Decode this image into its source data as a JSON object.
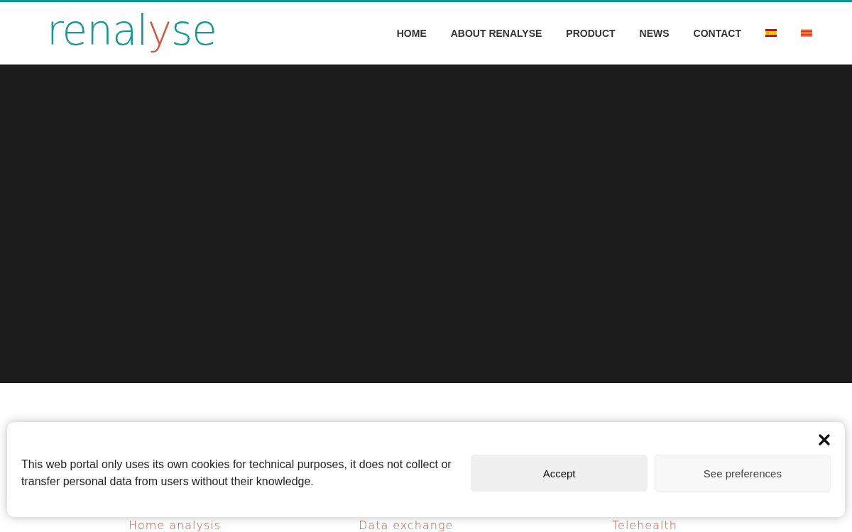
{
  "logo": [
    {
      "text": "renal",
      "accent": false
    },
    {
      "text": "y",
      "accent": true
    },
    {
      "text": "se",
      "accent": false
    }
  ],
  "nav": [
    {
      "label": "HOME"
    },
    {
      "label": "ABOUT RENALYSE"
    },
    {
      "label": "PRODUCT"
    },
    {
      "label": "NEWS"
    },
    {
      "label": "CONTACT"
    }
  ],
  "languages": [
    {
      "kind": "es"
    },
    {
      "kind": "ca"
    }
  ],
  "features": [
    {
      "title": "Home analysis"
    },
    {
      "title": "Data exchange"
    },
    {
      "title": "Telehealth"
    }
  ],
  "cookie_banner": {
    "message": "This web portal only uses its own cookies for technical purposes, it does not collect or transfer personal data from users without their knowledge.",
    "buttons": [
      {
        "label": "Accept",
        "kind": "primary"
      },
      {
        "label": "See preferences",
        "kind": "secondary"
      }
    ]
  }
}
